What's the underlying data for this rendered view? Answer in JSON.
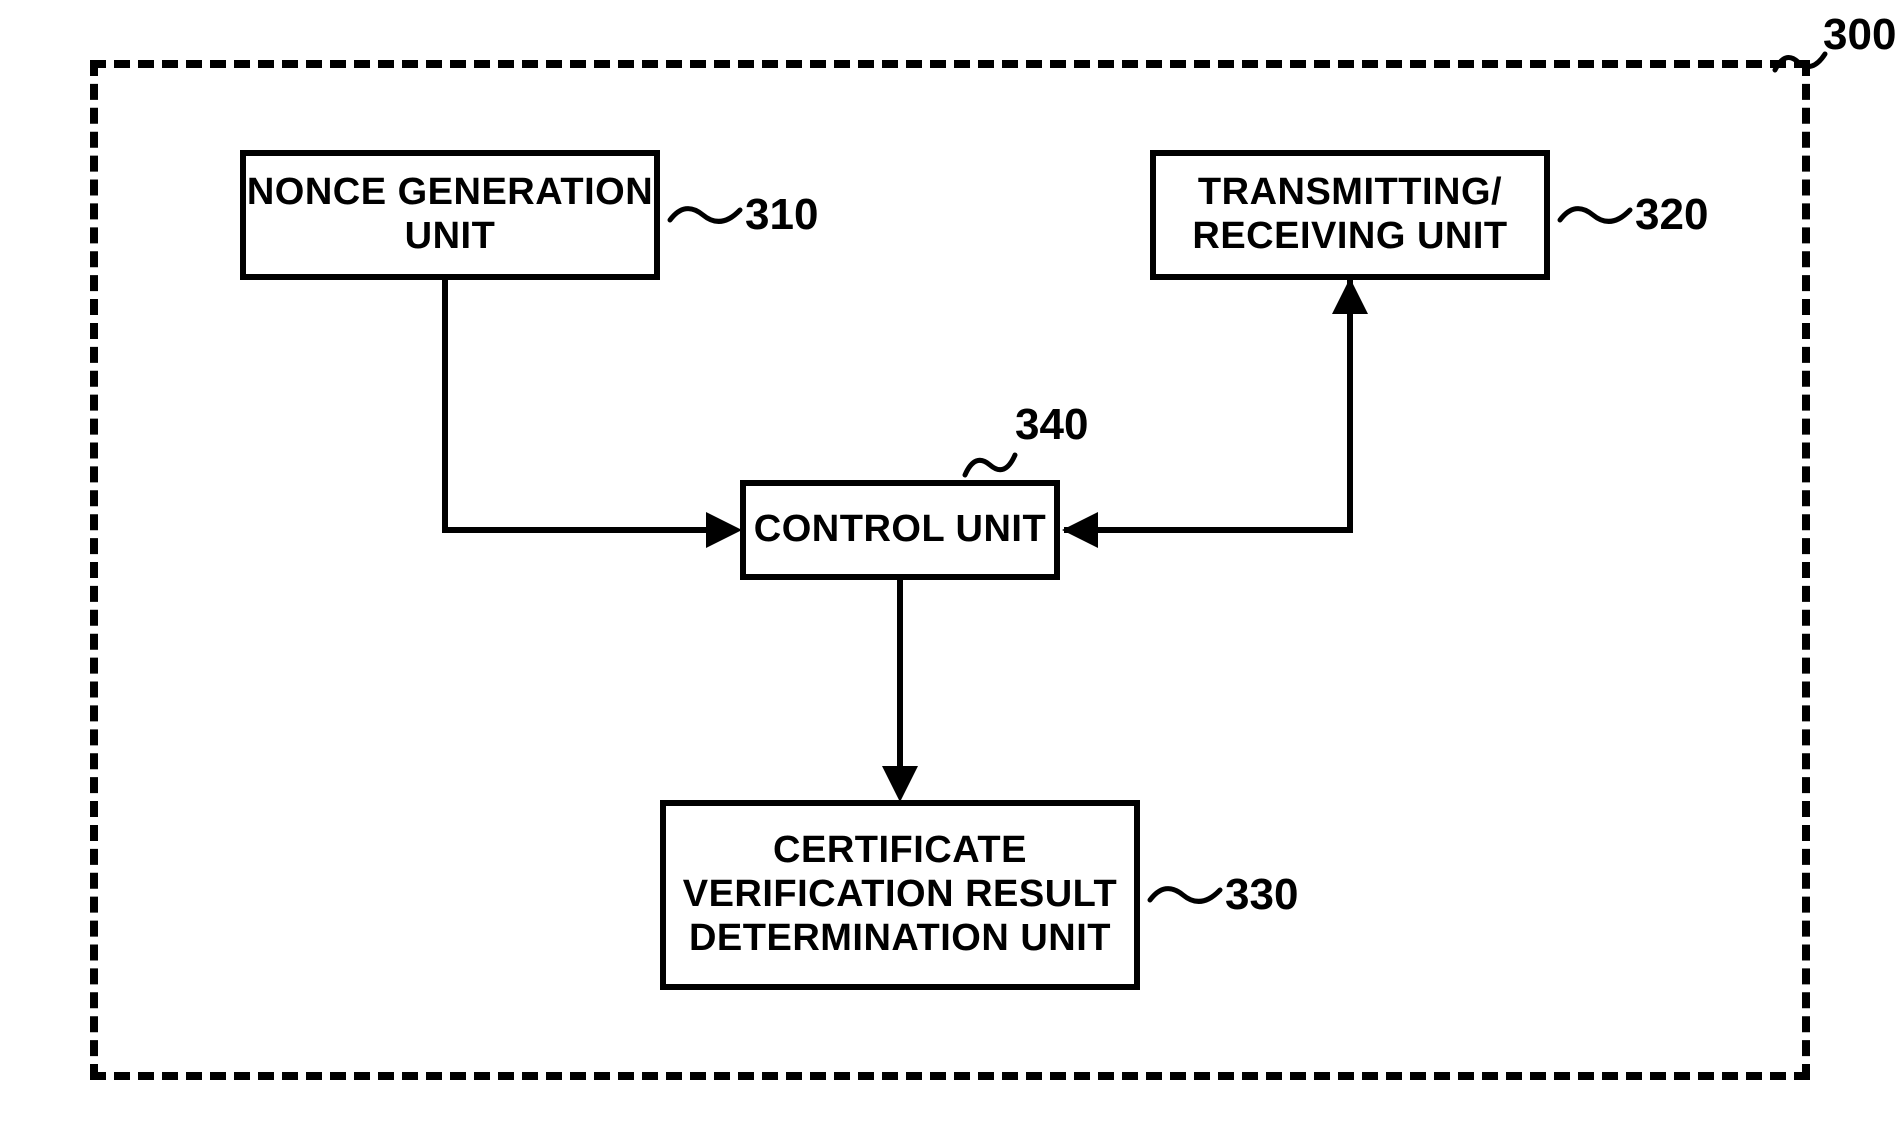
{
  "container": {
    "ref": "300"
  },
  "blocks": {
    "nonce": {
      "label": "NONCE GENERATION\nUNIT",
      "ref": "310"
    },
    "txrx": {
      "label": "TRANSMITTING/\nRECEIVING UNIT",
      "ref": "320"
    },
    "control": {
      "label": "CONTROL UNIT",
      "ref": "340"
    },
    "cert": {
      "label": "CERTIFICATE\nVERIFICATION RESULT\nDETERMINATION UNIT",
      "ref": "330"
    }
  }
}
